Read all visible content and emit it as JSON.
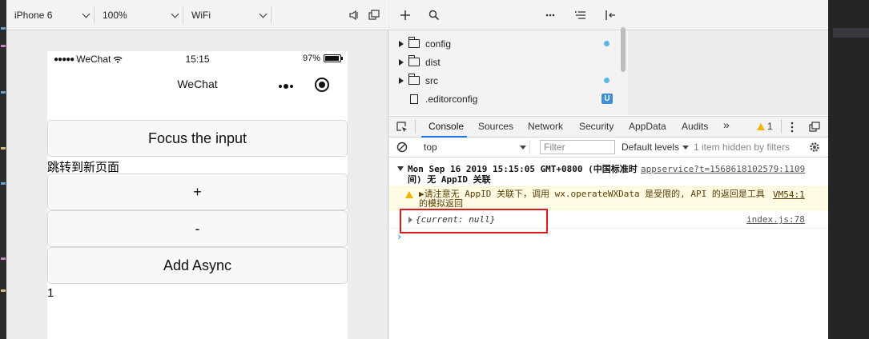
{
  "simulator": {
    "toolbar": {
      "device": "iPhone 6",
      "zoom": "100%",
      "network": "WiFi"
    },
    "status_bar": {
      "carrier": "WeChat",
      "time": "15:15",
      "battery": "97%",
      "battery_level": 0.97
    },
    "nav_bar": {
      "title": "WeChat"
    },
    "page": {
      "focus_button": "Focus the input",
      "navigate_text": "跳转到新页面",
      "plus_button": "+",
      "minus_button": "-",
      "async_button": "Add Async",
      "counter_value": "1"
    }
  },
  "file_tree": {
    "items": [
      {
        "type": "folder",
        "name": "config",
        "badge": "dot"
      },
      {
        "type": "folder",
        "name": "dist",
        "badge": ""
      },
      {
        "type": "folder",
        "name": "src",
        "badge": "dot"
      },
      {
        "type": "file",
        "name": ".editorconfig",
        "badge": "U"
      }
    ],
    "badge_color": "#5fb7e8",
    "u_badge_color": "#3d8fd8"
  },
  "devtools": {
    "tabs": [
      "Console",
      "Sources",
      "Network",
      "Security",
      "AppData",
      "Audits"
    ],
    "active_tab": "Console",
    "more_tabs": "»",
    "warning_count": "1",
    "context": "top",
    "filter_placeholder": "Filter",
    "levels": "Default levels",
    "hidden_items": "1 item hidden by filters",
    "accent_color": "#1a73e8"
  },
  "console": {
    "group_header": "Mon Sep 16 2019 15:15:05 GMT+0800 (中国标准时间) 无 AppID 关联",
    "group_link": "appservice?t=1568618102579:1109",
    "warning_text": "▶请注意无 AppID 关联下，调用 wx.operateWXData 是受限的, API 的返回是工具的模拟返回",
    "warning_link": "VM54:1",
    "object_text": "{current: null}",
    "object_link": "index.js:78",
    "prompt": "›",
    "highlight_color": "#e0191a"
  }
}
